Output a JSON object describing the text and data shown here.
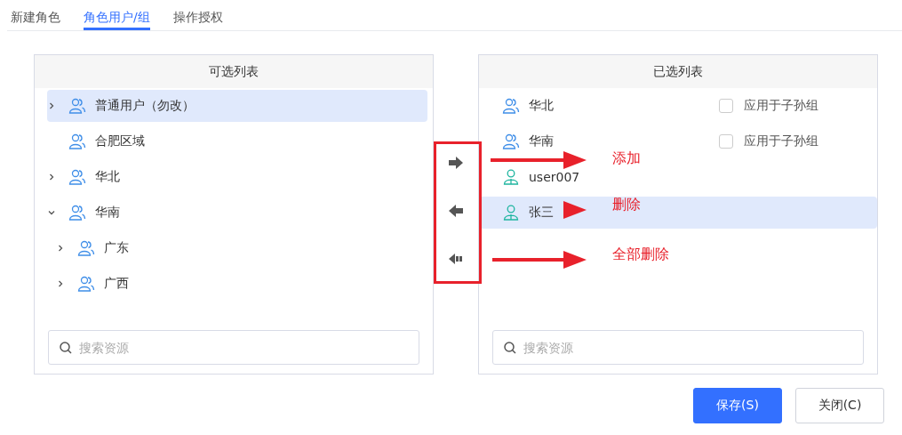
{
  "tabs": [
    {
      "label": "新建角色",
      "selected": false
    },
    {
      "label": "角色用户/组",
      "selected": true
    },
    {
      "label": "操作授权",
      "selected": false
    }
  ],
  "available": {
    "title": "可选列表",
    "items": [
      {
        "kind": "branch",
        "label": "普通用户（勿改）",
        "expanded": false,
        "selected": true
      },
      {
        "kind": "leaf",
        "label": "合肥区域",
        "selected": false
      },
      {
        "kind": "branch",
        "label": "华北",
        "expanded": false,
        "selected": false
      },
      {
        "kind": "branch",
        "label": "华南",
        "expanded": true,
        "selected": false,
        "children": [
          {
            "kind": "branch",
            "label": "广东",
            "expanded": false,
            "selected": false
          },
          {
            "kind": "branch",
            "label": "广西",
            "expanded": false,
            "selected": false
          }
        ]
      }
    ],
    "search": {
      "placeholder": "搜索资源"
    }
  },
  "transfer": [
    {
      "kind": "add"
    },
    {
      "kind": "remove"
    },
    {
      "kind": "remove-all"
    }
  ],
  "chosen": {
    "title": "已选列表",
    "items": [
      {
        "kind": "group",
        "label": "华北",
        "selected": false,
        "apply_label": "应用于子孙组",
        "checked": false
      },
      {
        "kind": "group",
        "label": "华南",
        "selected": false,
        "apply_label": "应用于子孙组",
        "checked": false
      },
      {
        "kind": "user",
        "label": "user007",
        "selected": false
      },
      {
        "kind": "user",
        "label": "张三",
        "selected": true
      }
    ],
    "search": {
      "placeholder": "搜索资源"
    }
  },
  "annotations": [
    "添加",
    "删除",
    "全部删除"
  ],
  "buttons": [
    {
      "kind": "primary",
      "label": "保存(S)"
    },
    {
      "kind": "default",
      "label": "关闭(C)"
    }
  ]
}
